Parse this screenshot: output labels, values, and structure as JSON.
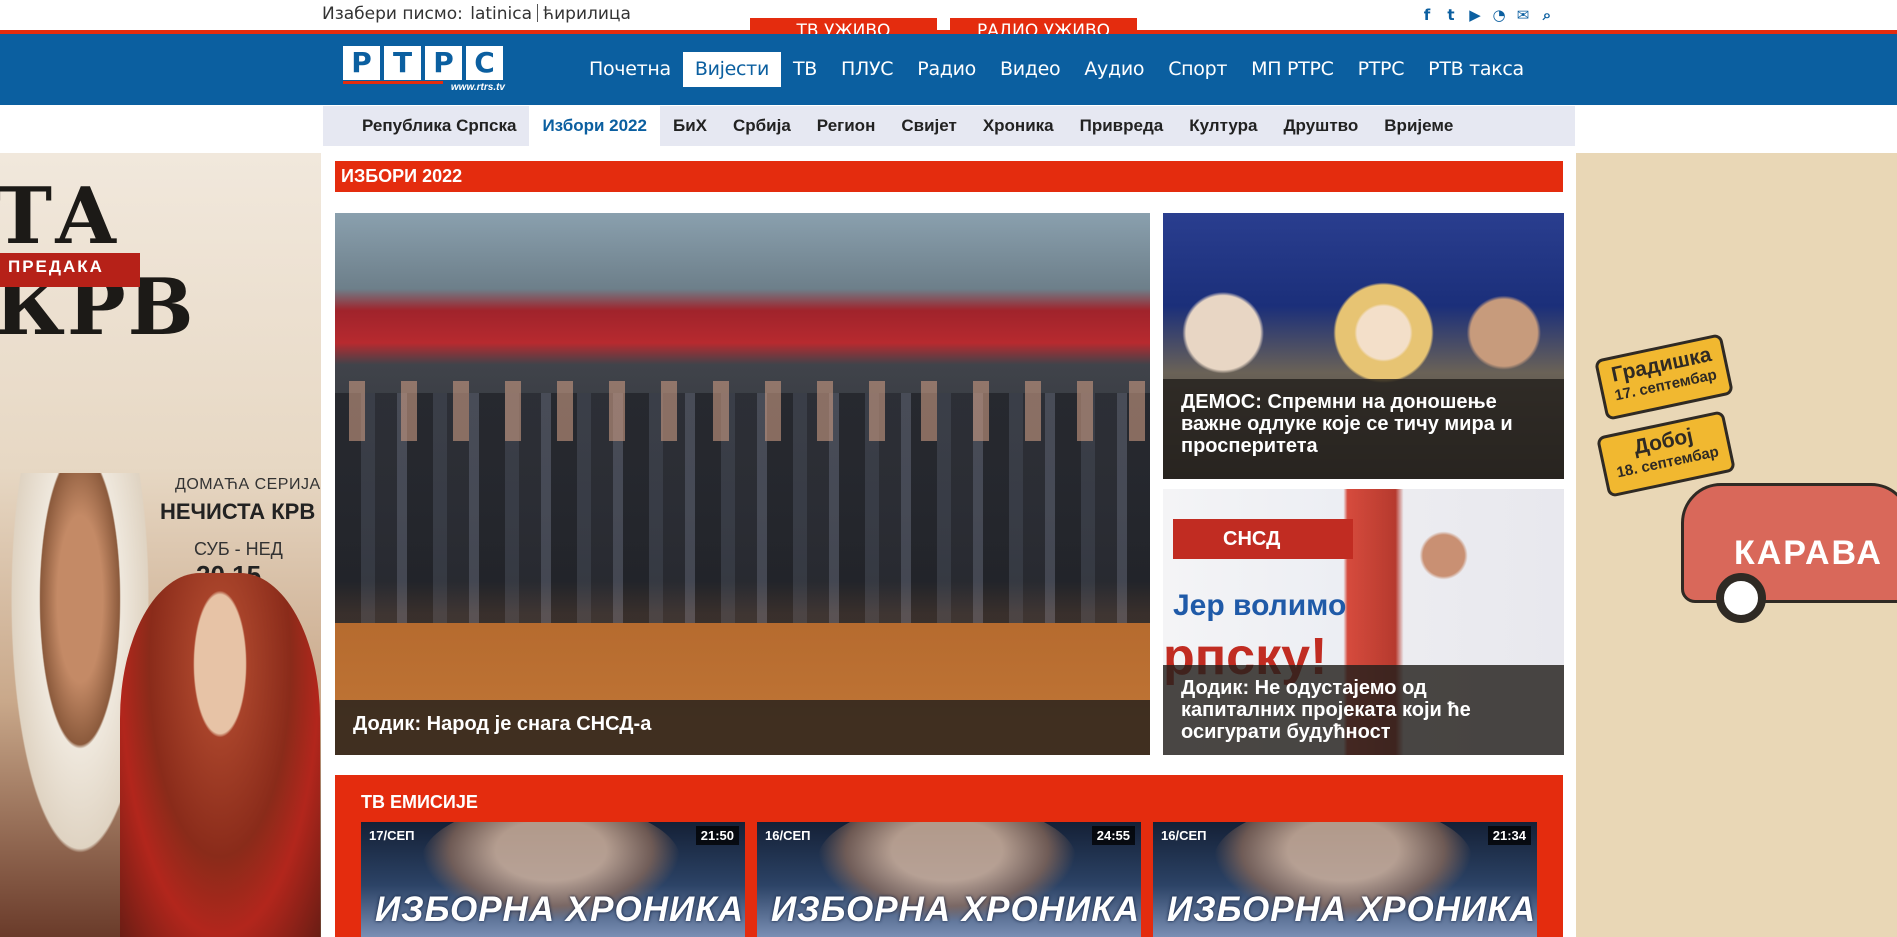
{
  "script_selector": {
    "label": "Изабери писмо:",
    "latin": "latinica",
    "cyrillic": "ћирилица"
  },
  "live": {
    "tv": "ТВ УЖИВО",
    "radio": "РАДИО УЖИВО"
  },
  "social_icons": [
    "facebook-icon",
    "twitter-icon",
    "youtube-icon",
    "rss-icon",
    "mail-icon",
    "search-icon"
  ],
  "logo": {
    "letters": [
      "Р",
      "Т",
      "Р",
      "С"
    ],
    "url": "www.rtrs.tv"
  },
  "main_nav": [
    {
      "label": "Почетна",
      "active": false
    },
    {
      "label": "Вијести",
      "active": true
    },
    {
      "label": "ТВ",
      "active": false
    },
    {
      "label": "ПЛУС",
      "active": false
    },
    {
      "label": "Радио",
      "active": false
    },
    {
      "label": "Видео",
      "active": false
    },
    {
      "label": "Аудио",
      "active": false
    },
    {
      "label": "Спорт",
      "active": false
    },
    {
      "label": "МП РТРС",
      "active": false
    },
    {
      "label": "РТРС",
      "active": false
    },
    {
      "label": "РТВ такса",
      "active": false
    }
  ],
  "sub_nav": [
    {
      "label": "Република Српска",
      "active": false
    },
    {
      "label": "Избори 2022",
      "active": true
    },
    {
      "label": "БиХ",
      "active": false
    },
    {
      "label": "Србија",
      "active": false
    },
    {
      "label": "Регион",
      "active": false
    },
    {
      "label": "Свијет",
      "active": false
    },
    {
      "label": "Хроника",
      "active": false
    },
    {
      "label": "Привреда",
      "active": false
    },
    {
      "label": "Култура",
      "active": false
    },
    {
      "label": "Друштво",
      "active": false
    },
    {
      "label": "Вријеме",
      "active": false
    }
  ],
  "ad_left": {
    "title": "ТА КРВ",
    "subtitle": "ПРЕДАКА",
    "line1": "ДОМАЋА СЕРИЈА",
    "line2": "НЕЧИСТА КРВ",
    "line3": "СУБ - НЕД",
    "line4": "20.15"
  },
  "ad_right": {
    "stop1_city": "Градишка",
    "stop1_date": "17. септембар",
    "stop2_city": "Добој",
    "stop2_date": "18. септембар",
    "bus_label": "КАРАВА"
  },
  "section_title": "ИЗБОРИ 2022",
  "stories": {
    "hero": "Додик: Народ је снага СНСД-а",
    "side1": "ДЕМОС: Спремни на доношење важне одлуке које се тичу мира и просперитета",
    "side2": "Додик: Не одустајемо од капиталних пројеката који ће осигурати будућност",
    "side2_banner1": "СНСД",
    "side2_banner2": "Јер волимо",
    "side2_banner3": "рпску!"
  },
  "tv_section": {
    "title": "ТВ ЕМИСИЈЕ",
    "cards": [
      {
        "date": "17/СЕП",
        "duration": "21:50",
        "show": "ИЗБОРНА ХРОНИКА"
      },
      {
        "date": "16/СЕП",
        "duration": "24:55",
        "show": "ИЗБОРНА ХРОНИКА"
      },
      {
        "date": "16/СЕП",
        "duration": "21:34",
        "show": "ИЗБОРНА ХРОНИКА"
      }
    ]
  },
  "colors": {
    "brand_blue": "#0b5fa0",
    "accent_red": "#e42c0e",
    "subnav_bg": "#e6e8f2"
  }
}
